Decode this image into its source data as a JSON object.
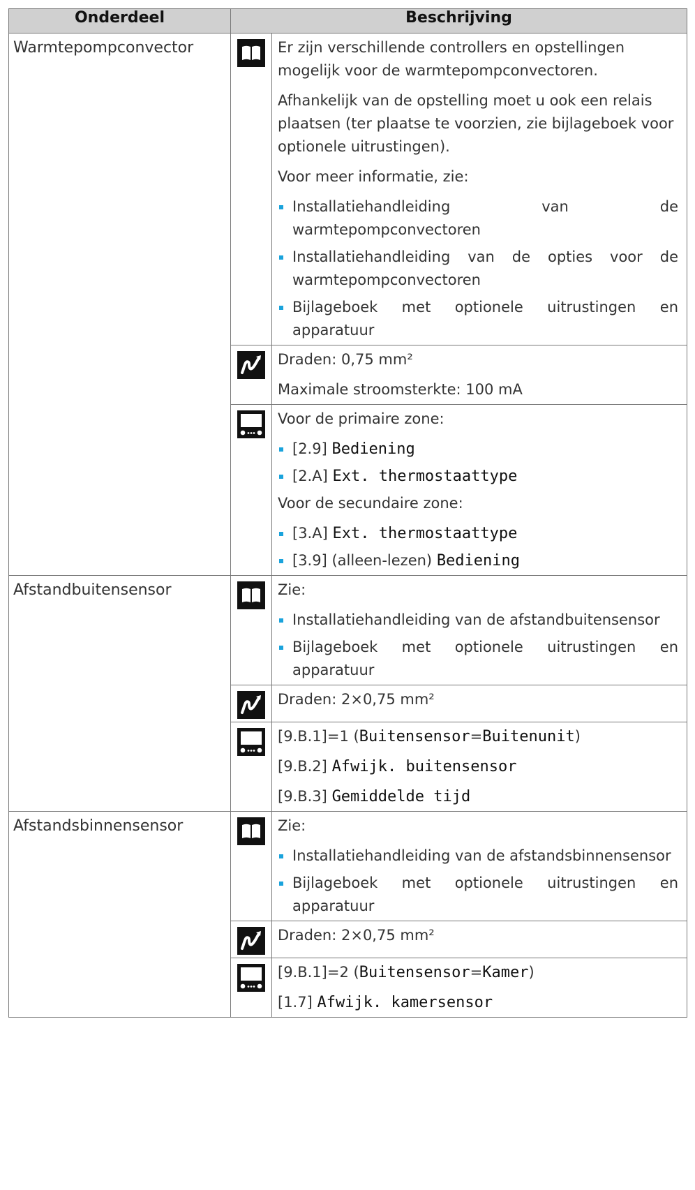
{
  "header": {
    "col1": "Onderdeel",
    "col2": "Beschrijving"
  },
  "rows": [
    {
      "item": "Warmtepompconvector",
      "manual": {
        "p1": "Er zijn verschillende controllers en opstellingen mogelijk voor de warmtepompconvectoren.",
        "p2": "Afhankelijk van de opstelling moet u ook een relais plaatsen (ter plaatse te voorzien, zie bijlageboek voor optionele uitrustingen).",
        "p3": "Voor meer informatie, zie:",
        "b1": "Installatiehandleiding van de warmtepompconvectoren",
        "b2": "Installatiehandleiding van de opties voor de warmtepompconvectoren",
        "b3": "Bijlageboek met optionele uitrustingen en apparatuur"
      },
      "wiring": {
        "l1": "Draden: 0,75 mm²",
        "l2": "Maximale stroomsterkte: 100 mA"
      },
      "settings": {
        "h1": "Voor de primaire zone:",
        "s1_code": "[2.9]",
        "s1_name": "Bediening",
        "s2_code": "[2.A]",
        "s2_name": "Ext. thermostaattype",
        "h2": "Voor de secundaire zone:",
        "s3_code": "[3.A]",
        "s3_name": "Ext. thermostaattype",
        "s4_code": "[3.9] (alleen-lezen)",
        "s4_name": "Bediening"
      }
    },
    {
      "item": "Afstandbuitensensor",
      "manual": {
        "p1": "Zie:",
        "b1": "Installatiehandleiding van de afstandbuitensensor",
        "b2": "Bijlageboek met optionele uitrustingen en apparatuur"
      },
      "wiring": {
        "l1": "Draden: 2×0,75 mm²"
      },
      "settings": {
        "l1_pre": "[9.B.1]=1 (",
        "l1_a": "Buitensensor",
        "l1_eq": "=",
        "l1_b": "Buitenunit",
        "l1_post": ")",
        "l2_code": "[9.B.2]",
        "l2_name": "Afwijk. buitensensor",
        "l3_code": "[9.B.3]",
        "l3_name": "Gemiddelde tijd"
      }
    },
    {
      "item": "Afstandsbinnensensor",
      "manual": {
        "p1": "Zie:",
        "b1": "Installatiehandleiding van de afstandsbinnensensor",
        "b2": "Bijlageboek met optionele uitrustingen en apparatuur"
      },
      "wiring": {
        "l1": "Draden: 2×0,75 mm²"
      },
      "settings": {
        "l1_pre": "[9.B.1]=2 (",
        "l1_a": "Buitensensor",
        "l1_eq": "=",
        "l1_b": "Kamer",
        "l1_post": ")",
        "l2_code": "[1.7]",
        "l2_name": "Afwijk. kamersensor"
      }
    }
  ],
  "icons": {
    "manual": "book-icon",
    "wiring": "wiring-icon",
    "settings": "user-interface-icon"
  }
}
